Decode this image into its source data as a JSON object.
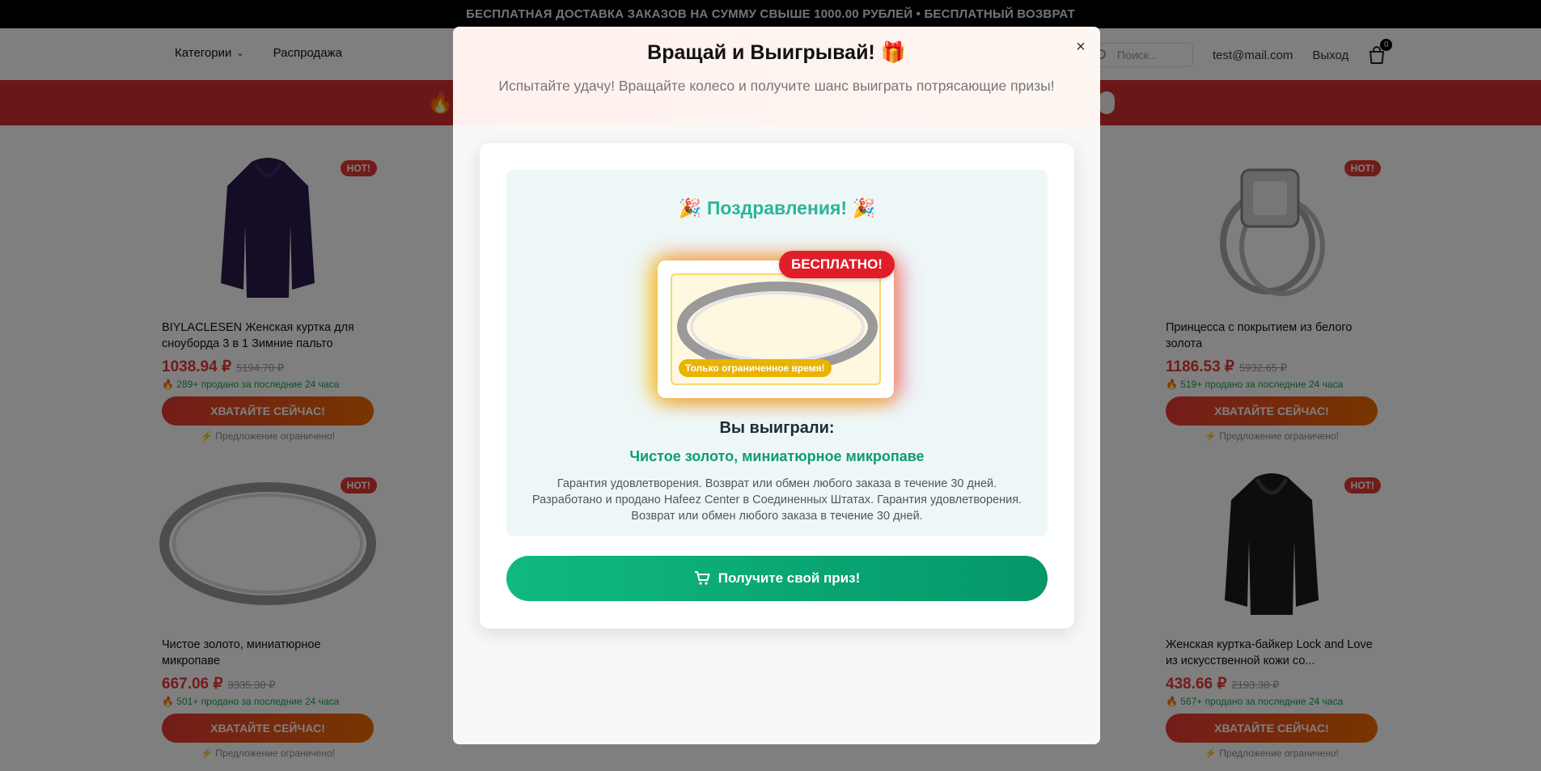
{
  "topbar": {
    "text": "БЕСПЛАТНАЯ ДОСТАВКА ЗАКАЗОВ НА СУММУ СВЫШЕ 1000.00 РУБЛЕЙ • БЕСПЛАТНЫЙ ВОЗВРАТ"
  },
  "header": {
    "categories": "Категории",
    "sale": "Распродажа",
    "search_placeholder": "Поиск...",
    "email": "test@mail.com",
    "logout": "Выход",
    "cart_count": "0"
  },
  "products": [
    {
      "title": "BIYLACLESEN Женская куртка для сноуборда 3 в 1 Зимние пальто",
      "price": "1038.94 ₽",
      "old_price": "5194.70 ₽",
      "sold": "🔥 289+ продано за последние 24 часа",
      "badge": "HOT!"
    },
    {
      "title": "Принцесса с покрытием из белого золота",
      "price": "1186.53 ₽",
      "old_price": "5932.65 ₽",
      "sold": "🔥 519+ продано за последние 24 часа",
      "badge": "HOT!"
    },
    {
      "title": "Чистое золото, миниатюрное микропаве",
      "price": "667.06 ₽",
      "old_price": "3335.30 ₽",
      "sold": "🔥 501+ продано за последние 24 часа",
      "badge": "HOT!"
    },
    {
      "title": "Женская куртка-байкер Lock and Love из искусственной кожи со...",
      "price": "438.66 ₽",
      "old_price": "2193.30 ₽",
      "sold": "🔥 567+ продано за последние 24 часа",
      "badge": "HOT!"
    }
  ],
  "grab_label": "ХВАТАЙТЕ СЕЙЧАС!",
  "limited_label": "⚡ Предложение ограничено!",
  "modal": {
    "title": "Вращай и Выигрывай! 🎁",
    "subtitle": "Испытайте удачу! Вращайте колесо и получите шанс выиграть потрясающие призы!",
    "close": "×",
    "congrats": "🎉 Поздравления! 🎉",
    "free_badge": "БЕСПЛАТНО!",
    "limited_time": "Только ограниченное время!",
    "won_label": "Вы выиграли:",
    "won_name": "Чистое золото, миниатюрное микропаве",
    "won_desc": "Гарантия удовлетворения. Возврат или обмен любого заказа в течение 30 дней. Разработано и продано Hafeez Center в Соединенных Штатах. Гарантия удовлетворения. Возврат или обмен любого заказа в течение 30 дней.",
    "claim_button": "Получите свой приз!"
  }
}
